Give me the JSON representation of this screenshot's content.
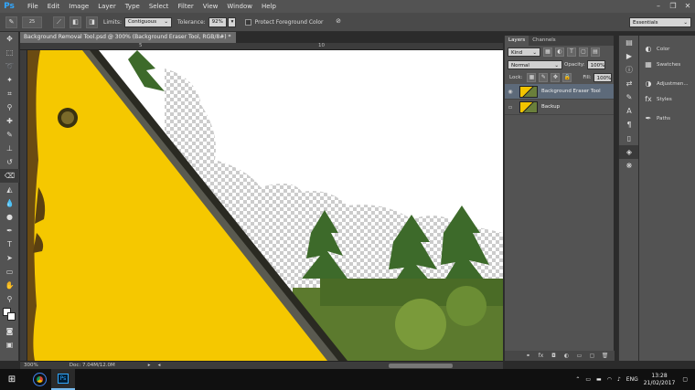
{
  "app": {
    "logo": "Ps"
  },
  "menu": [
    "File",
    "Edit",
    "Image",
    "Layer",
    "Type",
    "Select",
    "Filter",
    "View",
    "Window",
    "Help"
  ],
  "window_controls": [
    "–",
    "❐",
    "✕"
  ],
  "options": {
    "brush_size": "25",
    "limits_label": "Limits:",
    "limits_value": "Contiguous",
    "tolerance_label": "Tolerance:",
    "tolerance_value": "92%",
    "protect_label": "Protect Foreground Color",
    "workspace": "Essentials"
  },
  "document": {
    "tab_title": "Background Removal Tool.psd @ 300% (Background Eraser Tool, RGB/8#) *",
    "tab_close": "×",
    "ruler_marks": [
      "5",
      "10"
    ],
    "zoom": "300%",
    "doc_size": "Doc: 7.04M/12.0M"
  },
  "layers_panel": {
    "tabs": [
      "Layers",
      "Channels"
    ],
    "filter_kind": "Kind",
    "blend_mode": "Normal",
    "opacity_label": "Opacity:",
    "opacity_value": "100%",
    "lock_label": "Lock:",
    "fill_label": "Fill:",
    "fill_value": "100%",
    "layers": [
      {
        "name": "Background Eraser Tool",
        "visible": true,
        "selected": true
      },
      {
        "name": "Backup",
        "visible": false,
        "selected": false
      }
    ]
  },
  "side_panels": [
    {
      "icon": "color-icon",
      "label": "Color"
    },
    {
      "icon": "swatches-icon",
      "label": "Swatches"
    },
    {
      "icon": "adjustments-icon",
      "label": "Adjustmen..."
    },
    {
      "icon": "styles-icon",
      "label": "Styles"
    },
    {
      "icon": "paths-icon",
      "label": "Paths"
    }
  ],
  "taskbar": {
    "language": "ENG",
    "time": "13:28",
    "date": "21/02/2017"
  },
  "colors": {
    "accent": "#31a8ff",
    "sign_yellow": "#f5c800",
    "selection": "#5d6a7a"
  }
}
